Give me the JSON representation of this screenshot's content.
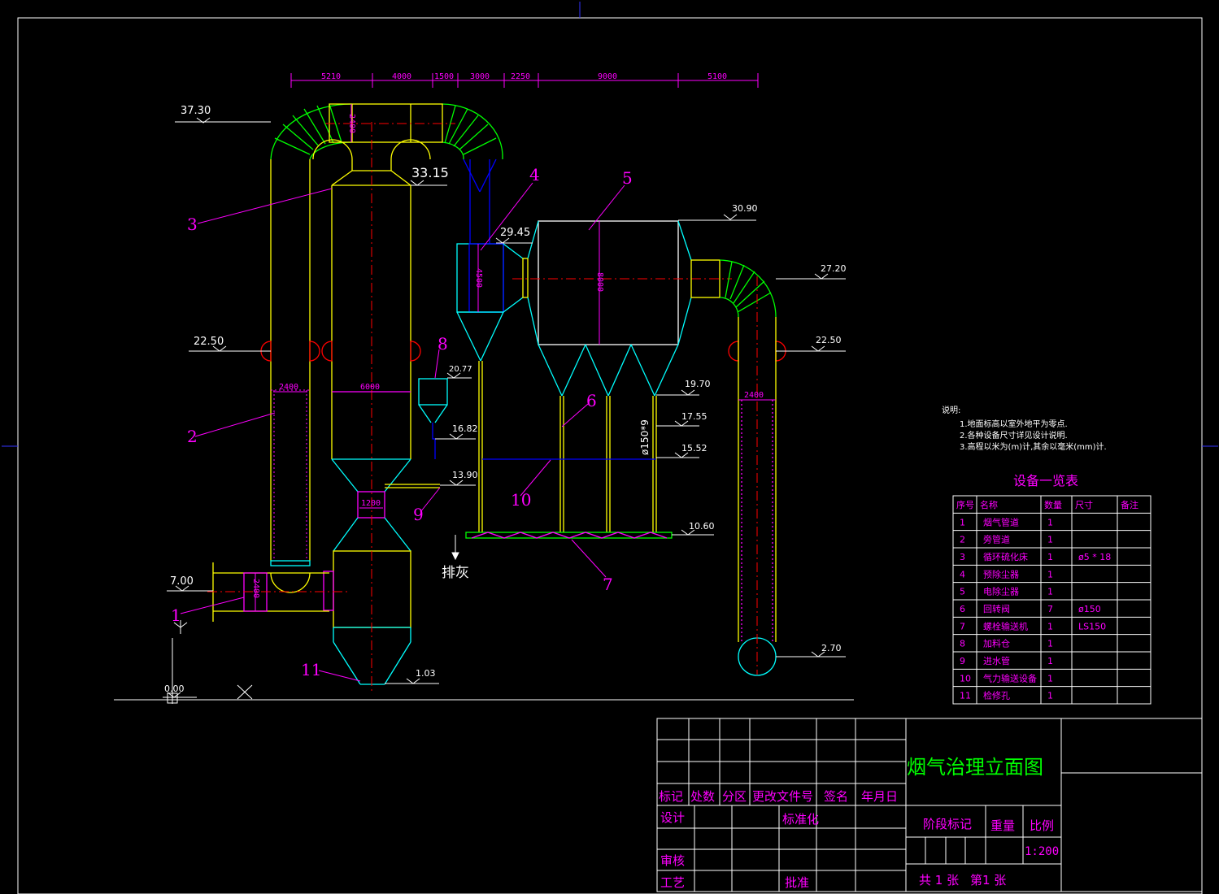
{
  "colors": {
    "background": "#000000",
    "border": "#ffffff",
    "duct": "#00ff00",
    "outline": "#ffff00",
    "hopper": "#00ffff",
    "pipe": "#0000ff",
    "leader": "#ff00ff",
    "centerline": "#ff0000",
    "title": "#00ff00"
  },
  "top_dimensions": [
    "5210",
    "4000",
    "1500",
    "3000",
    "2250",
    "9000",
    "5100"
  ],
  "elevations": {
    "e3730": "37.30",
    "e3315": "33.15",
    "e3090": "30.90",
    "e2945": "29.45",
    "e2720": "27.20",
    "e2250_left": "22.50",
    "e2250_right": "22.50",
    "e2077": "20.77",
    "e1970": "19.70",
    "e1755": "17.55",
    "e1682": "16.82",
    "e1552": "15.52",
    "e1390": "13.90",
    "e1060": "10.60",
    "e700": "7.00",
    "e270": "2.70",
    "e103": "1.03",
    "e000": "0.00"
  },
  "inner_dimensions": {
    "d2400_top": "2400",
    "d2400_left": "2400",
    "d6000": "6000",
    "d1200": "1200",
    "d4500": "4500",
    "d8000": "8000",
    "d2400_right": "2400",
    "d2400_inlet": "2400",
    "pipe_spec": "ø150*9"
  },
  "item_labels": [
    "1",
    "2",
    "3",
    "4",
    "5",
    "6",
    "7",
    "8",
    "9",
    "10",
    "11"
  ],
  "ash_discharge": "排灰",
  "notes": {
    "heading": "说明:",
    "lines": [
      "1.地面标高以室外地平为零点.",
      "2.各种设备尺寸详见设计说明.",
      "3.高程以米为(m)计,其余以毫米(mm)计."
    ]
  },
  "equipment_table": {
    "title": "设备一览表",
    "headers": [
      "序号",
      "名称",
      "数量",
      "尺寸",
      "备注"
    ],
    "rows": [
      [
        "1",
        "烟气管道",
        "1",
        "",
        ""
      ],
      [
        "2",
        "旁管道",
        "1",
        "",
        ""
      ],
      [
        "3",
        "循环硫化床",
        "1",
        "ø5 * 18",
        ""
      ],
      [
        "4",
        "预除尘器",
        "1",
        "",
        ""
      ],
      [
        "5",
        "电除尘器",
        "1",
        "",
        ""
      ],
      [
        "6",
        "回转阀",
        "7",
        "ø150",
        ""
      ],
      [
        "7",
        "螺栓输送机",
        "1",
        "LS150",
        ""
      ],
      [
        "8",
        "加料仓",
        "1",
        "",
        ""
      ],
      [
        "9",
        "进水管",
        "1",
        "",
        ""
      ],
      [
        "10",
        "气力输送设备",
        "1",
        "",
        ""
      ],
      [
        "11",
        "检修孔",
        "1",
        "",
        ""
      ]
    ]
  },
  "title_block": {
    "drawing_title": "烟气治理立面图",
    "mark": "标记",
    "count": "处数",
    "zone": "分区",
    "change_doc": "更改文件号",
    "signature": "签名",
    "date": "年月日",
    "design": "设计",
    "standardize": "标准化",
    "stage_mark": "阶段标记",
    "weight": "重量",
    "scale_label": "比例",
    "scale_value": "1:200",
    "review": "审核",
    "process": "工艺",
    "approve": "批准",
    "sheet_total": "共 1 张",
    "sheet_no": "第1 张"
  }
}
